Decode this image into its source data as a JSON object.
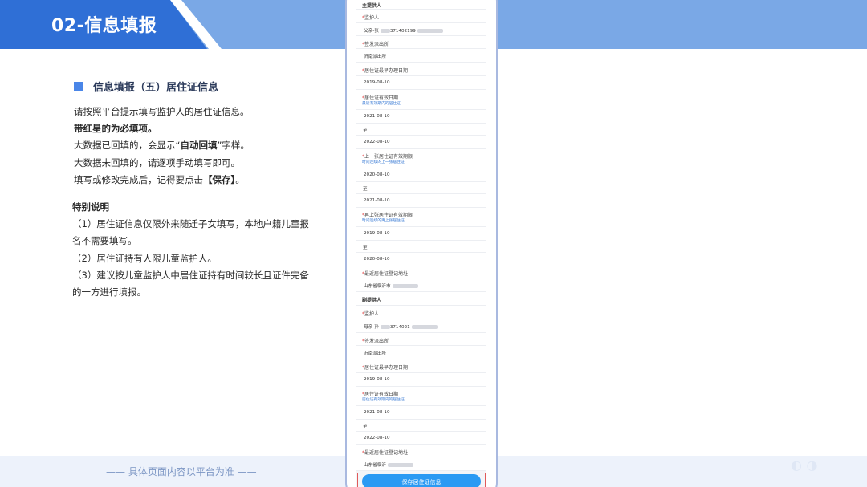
{
  "header": {
    "title": "02-信息填报"
  },
  "section": {
    "title": "信息填报（五）居住证信息"
  },
  "intro": {
    "l1": "请按照平台提示填写监护人的居住证信息。",
    "l2": "带红星的为必填项。",
    "l3a": "大数据已回填的，会显示“",
    "l3b": "自动回填",
    "l3c": "”字样。",
    "l4": "大数据未回填的，请逐项手动填写即可。",
    "l5a": "填写或修改完成后，记得要点击",
    "l5b": "【保存】",
    "l5c": "。"
  },
  "notes": {
    "title": "特别说明",
    "n1": "（1）居住证信息仅限外来随迁子女填写，本地户籍儿童报名不需要填写。",
    "n2": "（2）居住证持有人限儿童监护人。",
    "n3": "（3）建议按儿童监护人中居住证持有时间较长且证件完备的一方进行填报。"
  },
  "footer": {
    "note": "—— 具体页面内容以平台为准 ——"
  },
  "phone": {
    "g1": "主提供人",
    "guardian_label": "监护人",
    "g1_guardian": "父亲-张",
    "g1_guardian_id": "371402199",
    "issuer_label": "签发派出所",
    "g1_issuer": "沂南派出所",
    "earliest_label": "居住证最早办理日期",
    "g1_earliest": "2019-08-10",
    "valid_label": "居住证有效日期",
    "valid_hint1": "最近有效期内的居住证",
    "g1_valid_from": "2021-08-10",
    "to": "至",
    "g1_valid_to": "2022-08-10",
    "prev_label": "上一张居住证有效期限",
    "prev_hint": "时间连续的上一张居住证",
    "g1_prev_from": "2020-08-10",
    "g1_prev_to": "2021-08-10",
    "prev2_label": "再上张居住证有效期限",
    "prev2_hint": "时间连续的再上张居住证",
    "g1_prev2_from": "2019-08-10",
    "g1_prev2_to": "2020-08-10",
    "addr_label": "最近居住证登记地址",
    "g1_addr": "山东省临沂市",
    "g2": "副提供人",
    "g2_guardian": "母亲-孙",
    "g2_guardian_id": "3714021",
    "g2_issuer": "沂南派出所",
    "g2_earliest": "2019-08-10",
    "valid_hint2": "居住证有效期内的居住证",
    "g2_valid_from": "2021-08-10",
    "g2_valid_to": "2022-08-10",
    "g2_addr": "山东省临沂",
    "save_label": "保存居住证信息"
  },
  "colors": {
    "primary": "#2f6fd6",
    "band": "#7aa8e6",
    "button": "#2b9af3",
    "required": "#e23c3c"
  }
}
